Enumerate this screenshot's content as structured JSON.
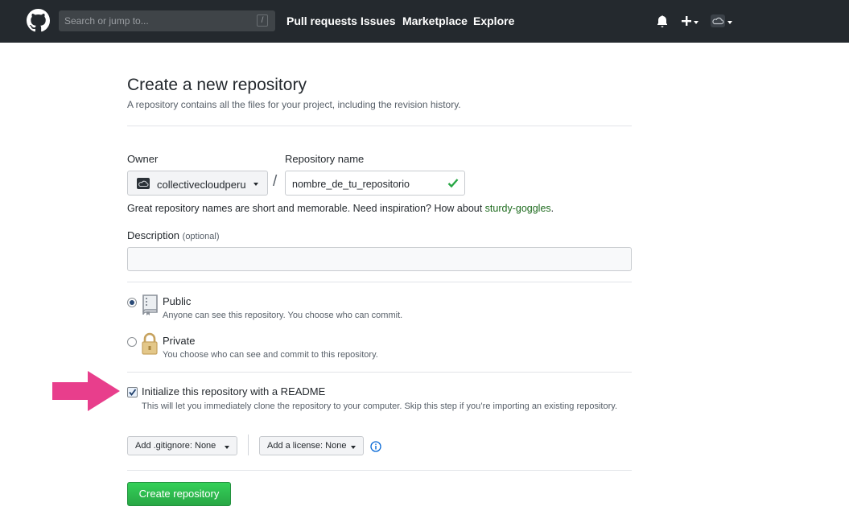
{
  "header": {
    "search_placeholder": "Search or jump to...",
    "search_shortcut": "/",
    "nav": [
      "Pull requests",
      "Issues",
      "Marketplace",
      "Explore"
    ]
  },
  "page": {
    "title": "Create a new repository",
    "subtitle": "A repository contains all the files for your project, including the revision history."
  },
  "form": {
    "owner_label": "Owner",
    "owner_value": "collectivecloudperu",
    "separator": "/",
    "repo_label": "Repository name",
    "repo_value": "nombre_de_tu_repositorio",
    "hint_text": "Great repository names are short and memorable. Need inspiration? How about ",
    "hint_suggestion": "sturdy-goggles",
    "hint_end": ".",
    "description_label": "Description",
    "description_optional": "(optional)",
    "description_value": "",
    "visibility": {
      "selected": "public",
      "public_title": "Public",
      "public_desc": "Anyone can see this repository. You choose who can commit.",
      "private_title": "Private",
      "private_desc": "You choose who can see and commit to this repository."
    },
    "readme": {
      "checked": true,
      "title": "Initialize this repository with a README",
      "desc": "This will let you immediately clone the repository to your computer. Skip this step if you’re importing an existing repository."
    },
    "gitignore_label": "Add .gitignore:",
    "gitignore_value": "None",
    "license_label": "Add a license:",
    "license_value": "None",
    "submit_label": "Create repository"
  },
  "colors": {
    "header_bg": "#24292e",
    "primary_button": "#2ea44f",
    "arrow": "#e83e8c",
    "valid_check": "#28a745"
  }
}
